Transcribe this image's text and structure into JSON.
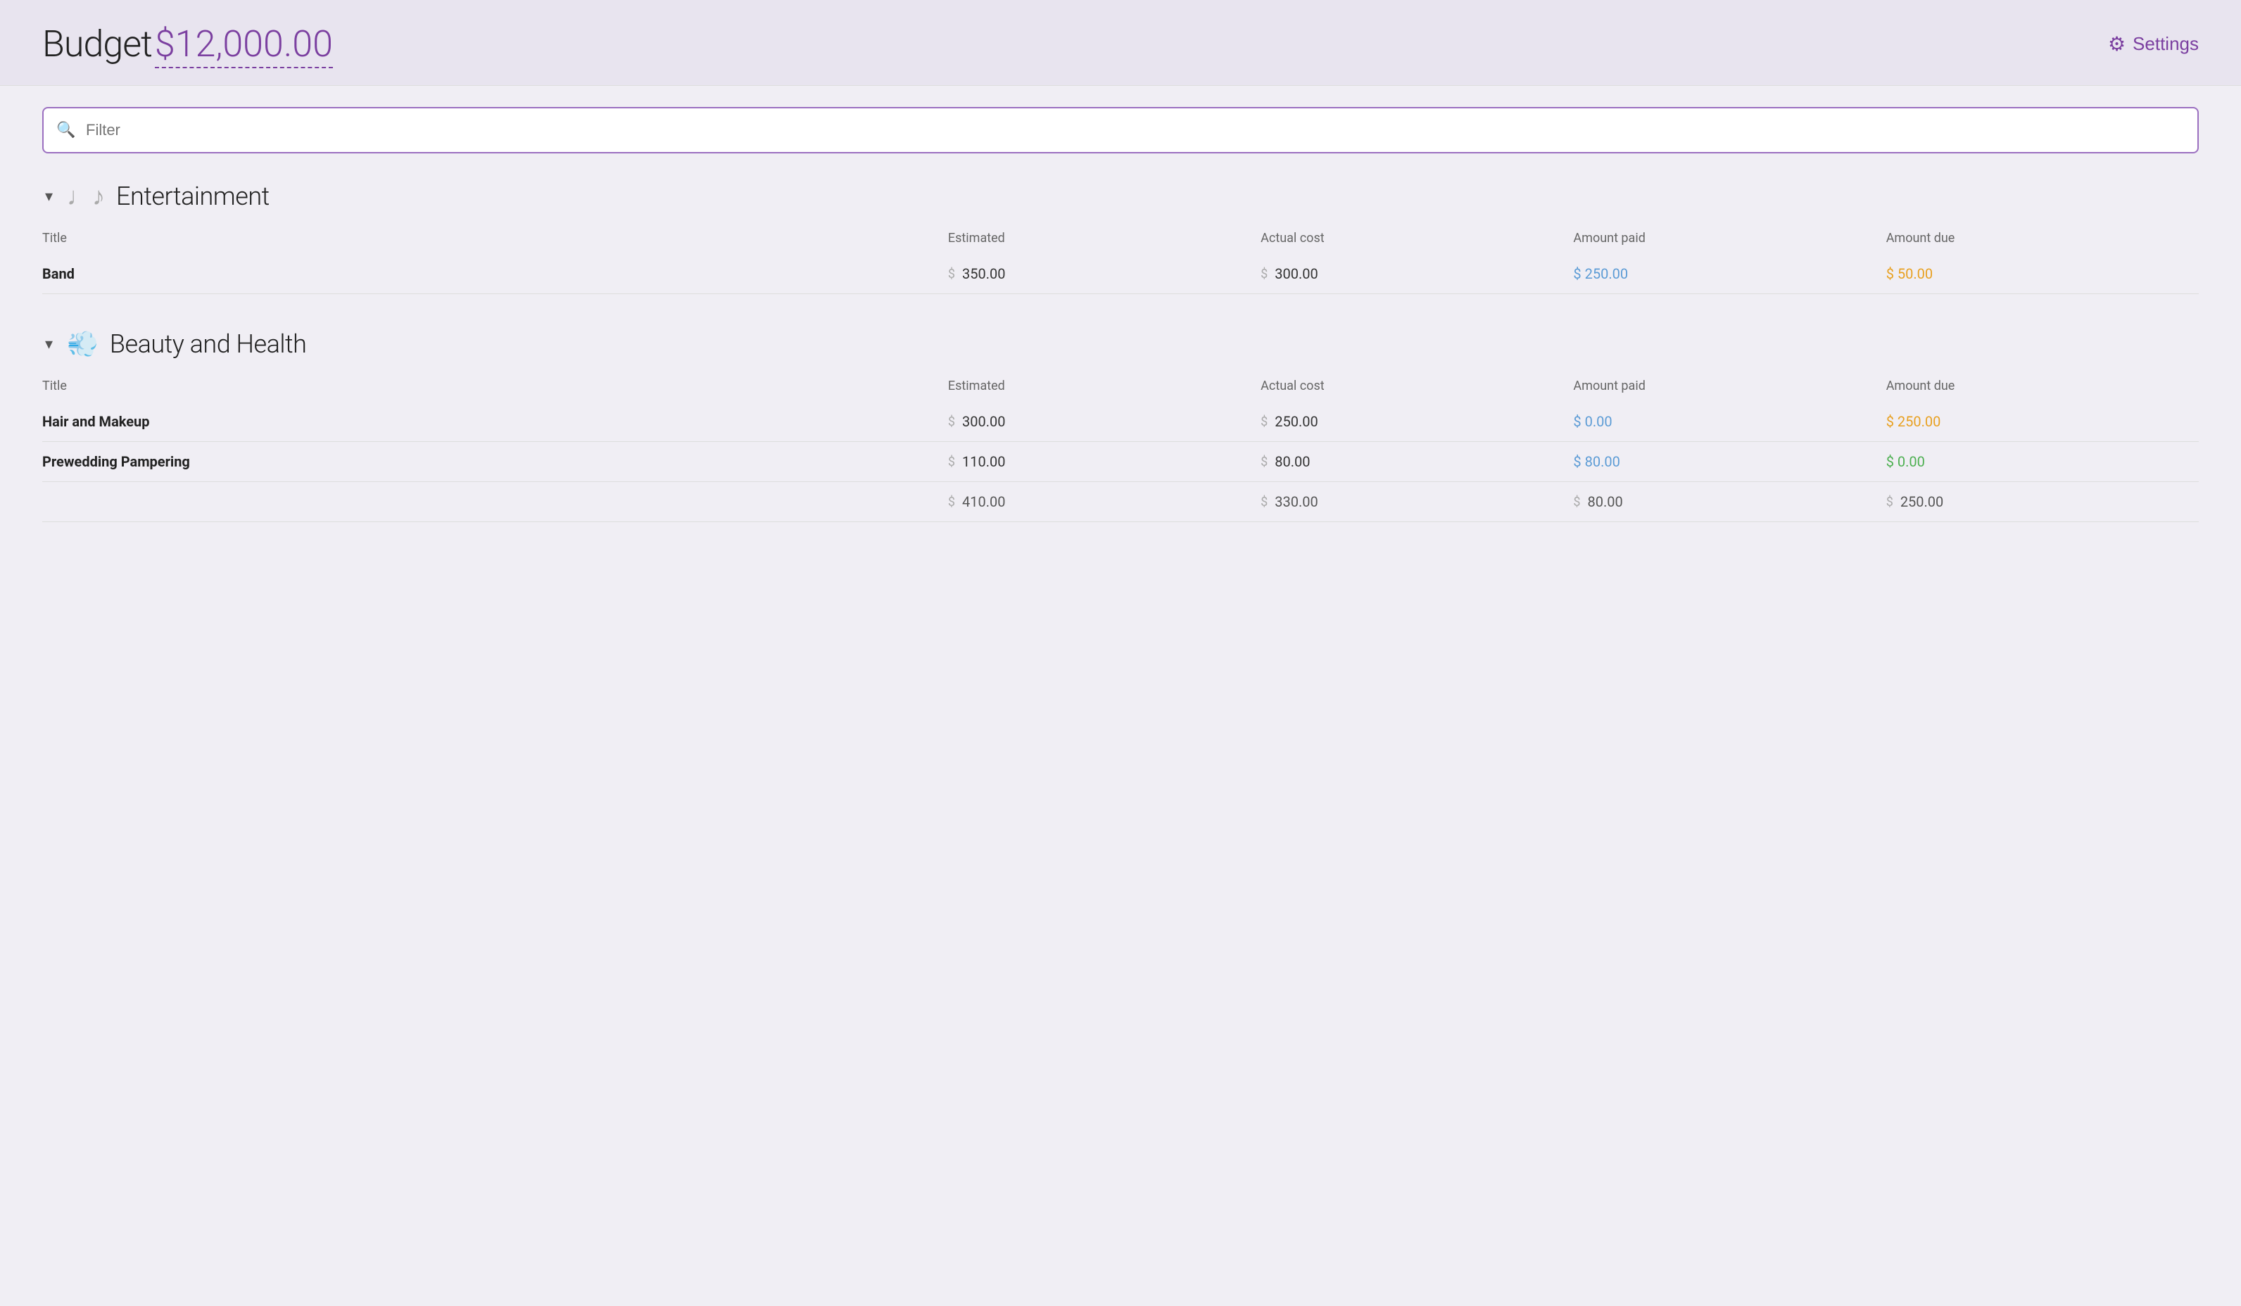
{
  "header": {
    "title_prefix": "Budget",
    "amount": "$12,000.00",
    "settings_label": "Settings"
  },
  "filter": {
    "placeholder": "Filter"
  },
  "categories": [
    {
      "id": "entertainment",
      "icon": "♩♪♫",
      "name": "Entertainment",
      "columns": [
        "Title",
        "Estimated",
        "Actual cost",
        "Amount paid",
        "Amount due"
      ],
      "rows": [
        {
          "title": "Band",
          "estimated": "350.00",
          "actual_cost": "300.00",
          "amount_paid": "250.00",
          "amount_due": "50.00",
          "paid_color": "blue",
          "due_color": "orange"
        }
      ],
      "totals": null
    },
    {
      "id": "beauty-health",
      "icon": "💨",
      "name": "Beauty and Health",
      "columns": [
        "Title",
        "Estimated",
        "Actual cost",
        "Amount paid",
        "Amount due"
      ],
      "rows": [
        {
          "title": "Hair and Makeup",
          "estimated": "300.00",
          "actual_cost": "250.00",
          "amount_paid": "0.00",
          "amount_due": "250.00",
          "paid_color": "blue",
          "due_color": "orange"
        },
        {
          "title": "Prewedding Pampering",
          "estimated": "110.00",
          "actual_cost": "80.00",
          "amount_paid": "80.00",
          "amount_due": "0.00",
          "paid_color": "blue",
          "due_color": "green"
        }
      ],
      "totals": {
        "estimated": "410.00",
        "actual_cost": "330.00",
        "amount_paid": "80.00",
        "amount_due": "250.00"
      }
    }
  ]
}
